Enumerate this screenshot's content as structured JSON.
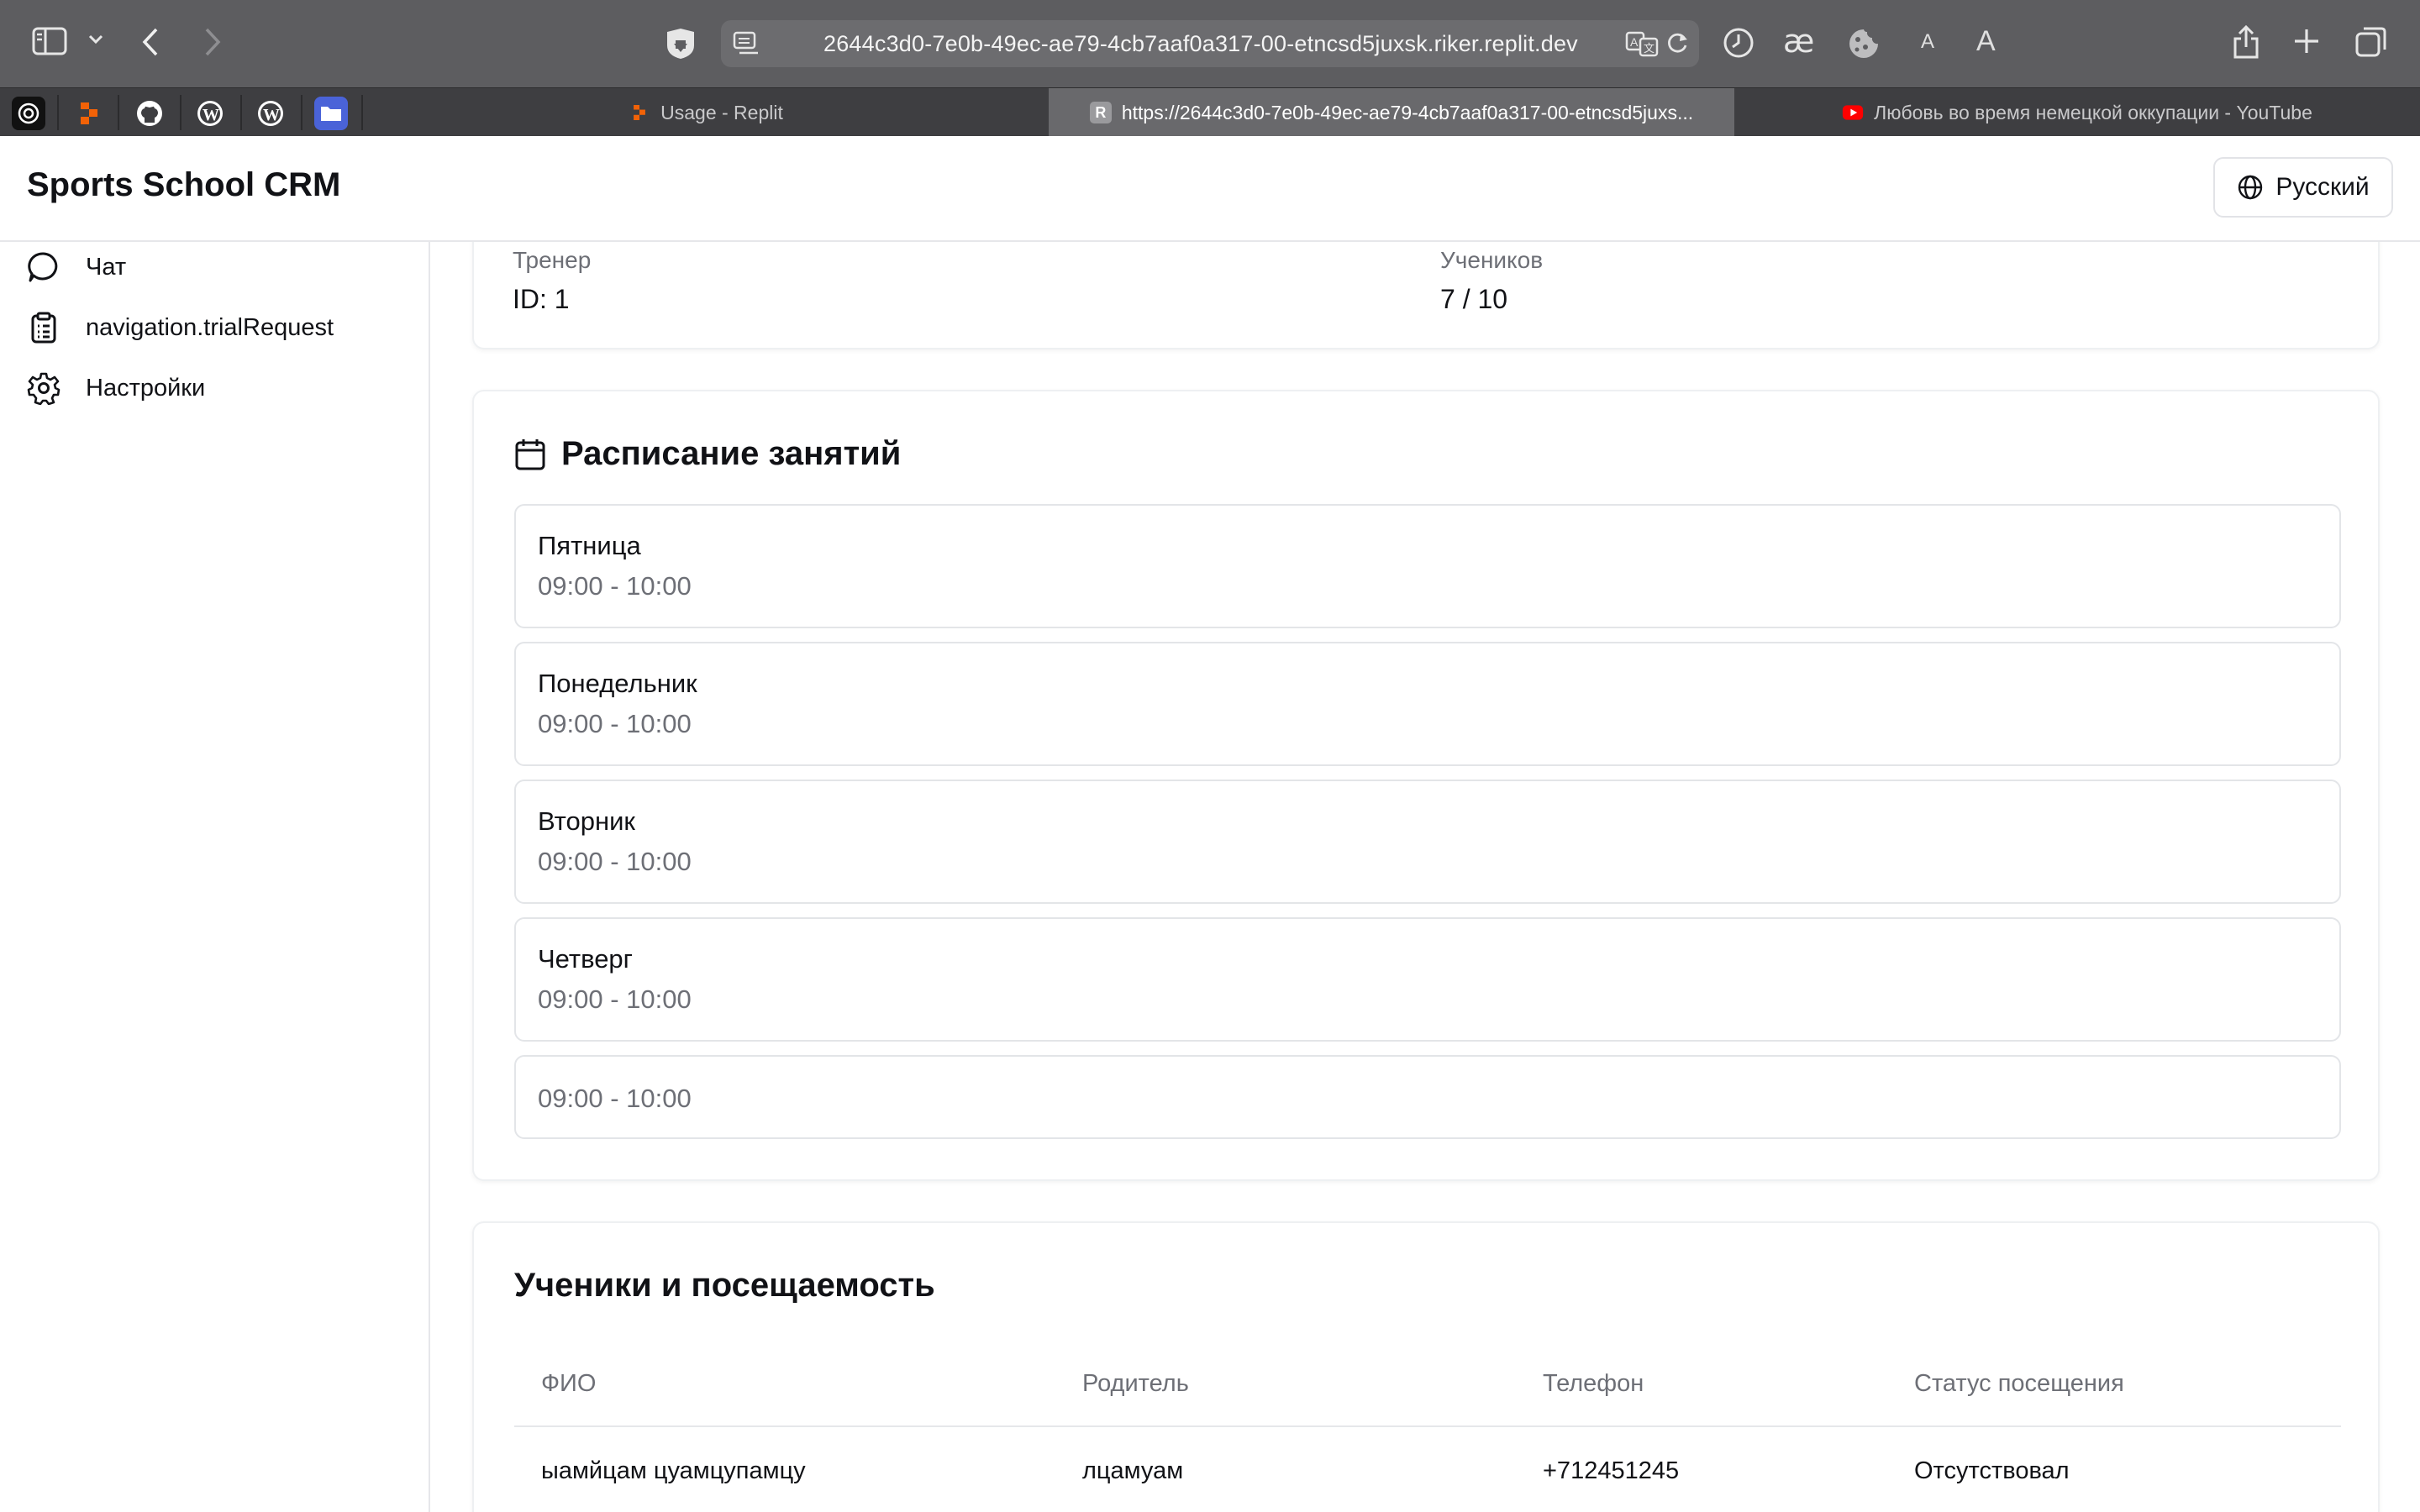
{
  "browser": {
    "url": "2644c3d0-7e0b-49ec-ae79-4cb7aaf0a317-00-etncsd5juxsk.riker.replit.dev",
    "font_small": "A",
    "font_large": "A",
    "tabs": [
      {
        "label": "Usage - Replit",
        "active": false
      },
      {
        "label": "https://2644c3d0-7e0b-49ec-ae79-4cb7aaf0a317-00-etncsd5juxs...",
        "active": true
      },
      {
        "label": "Любовь во время немецкой оккупации - YouTube",
        "active": false
      }
    ],
    "tab_r_letter": "R"
  },
  "header": {
    "title": "Sports School CRM",
    "language": "Русский"
  },
  "sidebar": {
    "items": [
      {
        "label": "Чат",
        "icon": "chat-icon"
      },
      {
        "label": "navigation.trialRequest",
        "icon": "clipboard-icon"
      },
      {
        "label": "Настройки",
        "icon": "gear-icon"
      }
    ]
  },
  "group_info": {
    "trainer_label": "Тренер",
    "trainer_value": "ID: 1",
    "students_label": "Учеников",
    "students_value": "7 / 10"
  },
  "schedule": {
    "title": "Расписание занятий",
    "slots": [
      {
        "day": "Пятница",
        "time": "09:00 - 10:00"
      },
      {
        "day": "Понедельник",
        "time": "09:00 - 10:00"
      },
      {
        "day": "Вторник",
        "time": "09:00 - 10:00"
      },
      {
        "day": "Четверг",
        "time": "09:00 - 10:00"
      },
      {
        "day": "",
        "time": "09:00 - 10:00"
      }
    ]
  },
  "attendance": {
    "title": "Ученики и посещаемость",
    "columns": [
      "ФИО",
      "Родитель",
      "Телефон",
      "Статус посещения"
    ],
    "rows": [
      {
        "name": "ыамйцам цуамцупамцу",
        "parent": "лцамуам",
        "phone": "+712451245",
        "status": "Отсутствовал"
      }
    ]
  },
  "colors": {
    "absent": "#dc2626",
    "muted": "#6d6f76",
    "border": "#e3e5e8"
  }
}
